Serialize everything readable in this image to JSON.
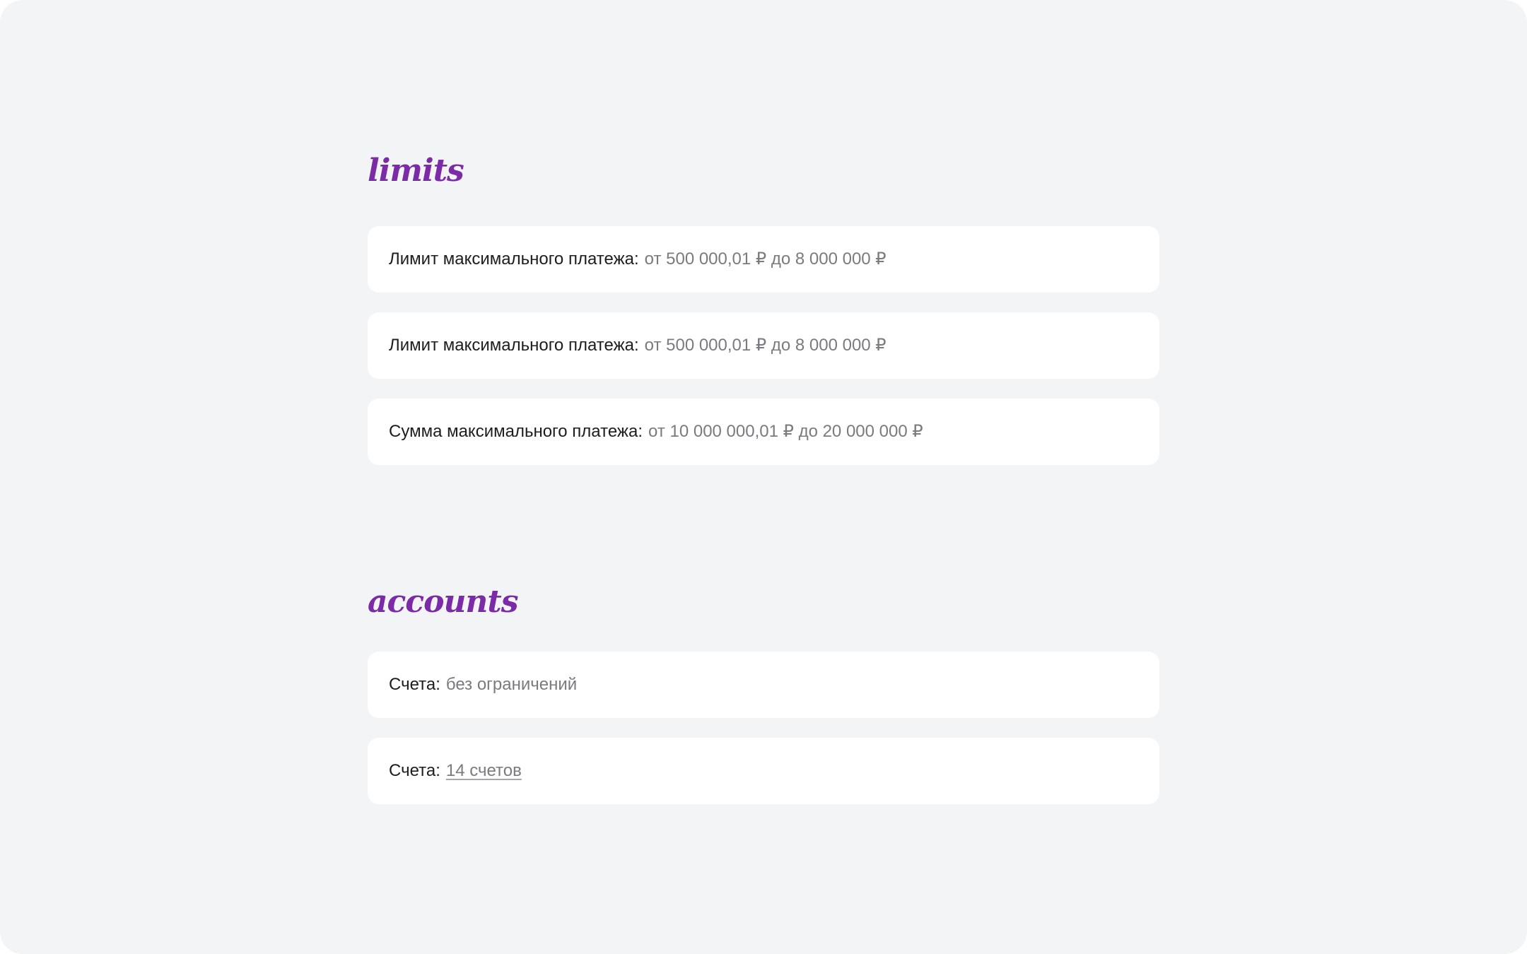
{
  "limits": {
    "title": "limits",
    "items": [
      {
        "label": "Лимит максимального платежа:",
        "value": "от 500 000,01 ₽ до 8 000 000 ₽"
      },
      {
        "label": "Лимит максимального платежа:",
        "value": "от 500 000,01 ₽ до 8 000 000 ₽"
      },
      {
        "label": "Сумма максимального платежа:",
        "value": "от 10 000 000,01 ₽ до 20 000 000 ₽"
      }
    ]
  },
  "accounts": {
    "title": "accounts",
    "items": [
      {
        "label": "Счета:",
        "value": "без ограничений"
      },
      {
        "label": "Счета:",
        "link": "14 счетов"
      }
    ]
  },
  "colors": {
    "background": "#f3f4f6",
    "card": "#ffffff",
    "section_title": "#7b2aa8",
    "label_text": "#1d1d1f",
    "value_text": "#7a7a80"
  }
}
